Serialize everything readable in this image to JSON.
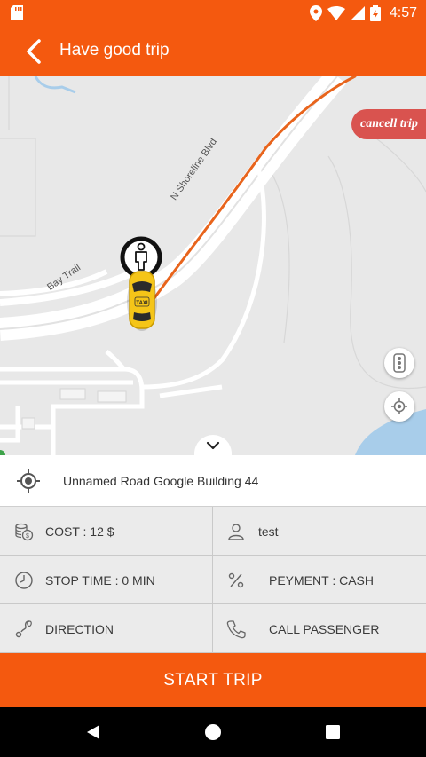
{
  "status_bar": {
    "time": "4:57"
  },
  "header": {
    "title": "Have good trip"
  },
  "map": {
    "road_labels": {
      "n_shoreline": "N Shoreline Blvd",
      "bay_trail": "Bay Trail"
    },
    "cancel_trip_label": "cancell trip",
    "taxi_label": "TAXI"
  },
  "address": {
    "text": "Unnamed Road Google Building 44"
  },
  "details": {
    "cost": "COST :  12 $",
    "passenger_name": "test",
    "stop_time": "STOP TIME : 0 MIN",
    "payment": "PEYMENT : CASH",
    "direction": "DIRECTION",
    "call_passenger": "CALL PASSENGER"
  },
  "actions": {
    "start_trip": "START TRIP"
  },
  "colors": {
    "accent": "#f4590f",
    "cancel": "#d9534f",
    "route": "#e8641c",
    "taxi": "#f5c518"
  }
}
